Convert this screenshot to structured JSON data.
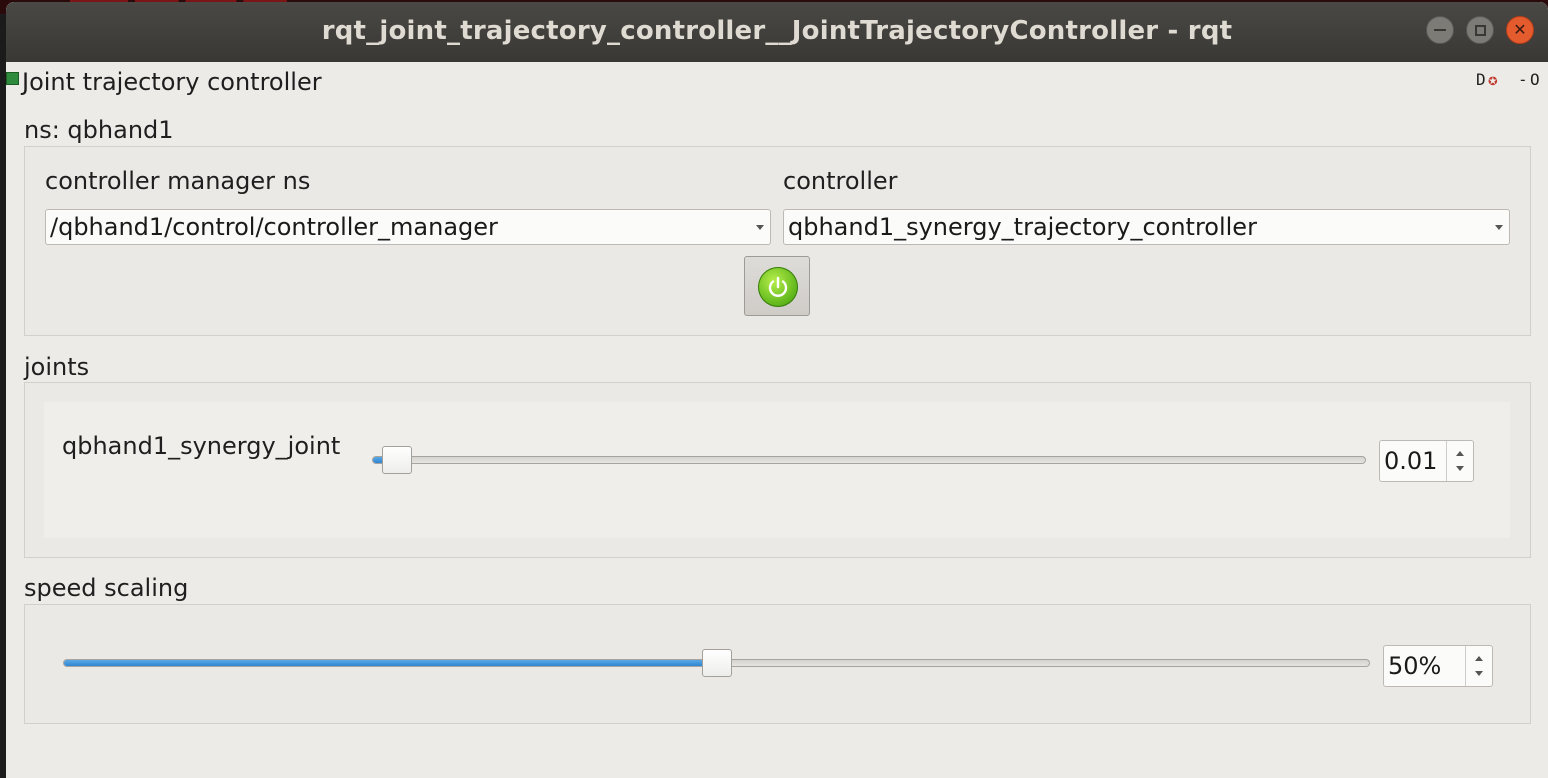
{
  "window": {
    "title": "rqt_joint_trajectory_controller__JointTrajectoryController - rqt",
    "minimize_icon": "minimize-icon",
    "maximize_icon": "maximize-icon",
    "close_icon": "close-icon"
  },
  "plugin": {
    "title": "Joint trajectory controller",
    "icon": "plugin-icon",
    "tools_text": "D☺ -O"
  },
  "ns_section": {
    "label": "ns: qbhand1",
    "cm_label": "controller manager ns",
    "cm_value": "/qbhand1/control/controller_manager",
    "controller_label": "controller",
    "controller_value": "qbhand1_synergy_trajectory_controller",
    "enable_icon": "power-icon",
    "enable_state_color": "#5cb419"
  },
  "joints_section": {
    "label": "joints",
    "joints": [
      {
        "name": "qbhand1_synergy_joint",
        "value": "0.01",
        "fraction": 0.01
      }
    ]
  },
  "speed_section": {
    "label": "speed scaling",
    "value": "50%",
    "fraction": 0.5
  },
  "colors": {
    "accent": "#2f86d2",
    "window_bg": "#edebe8",
    "titlebar": "#3a3835",
    "close": "#e45b2d"
  }
}
